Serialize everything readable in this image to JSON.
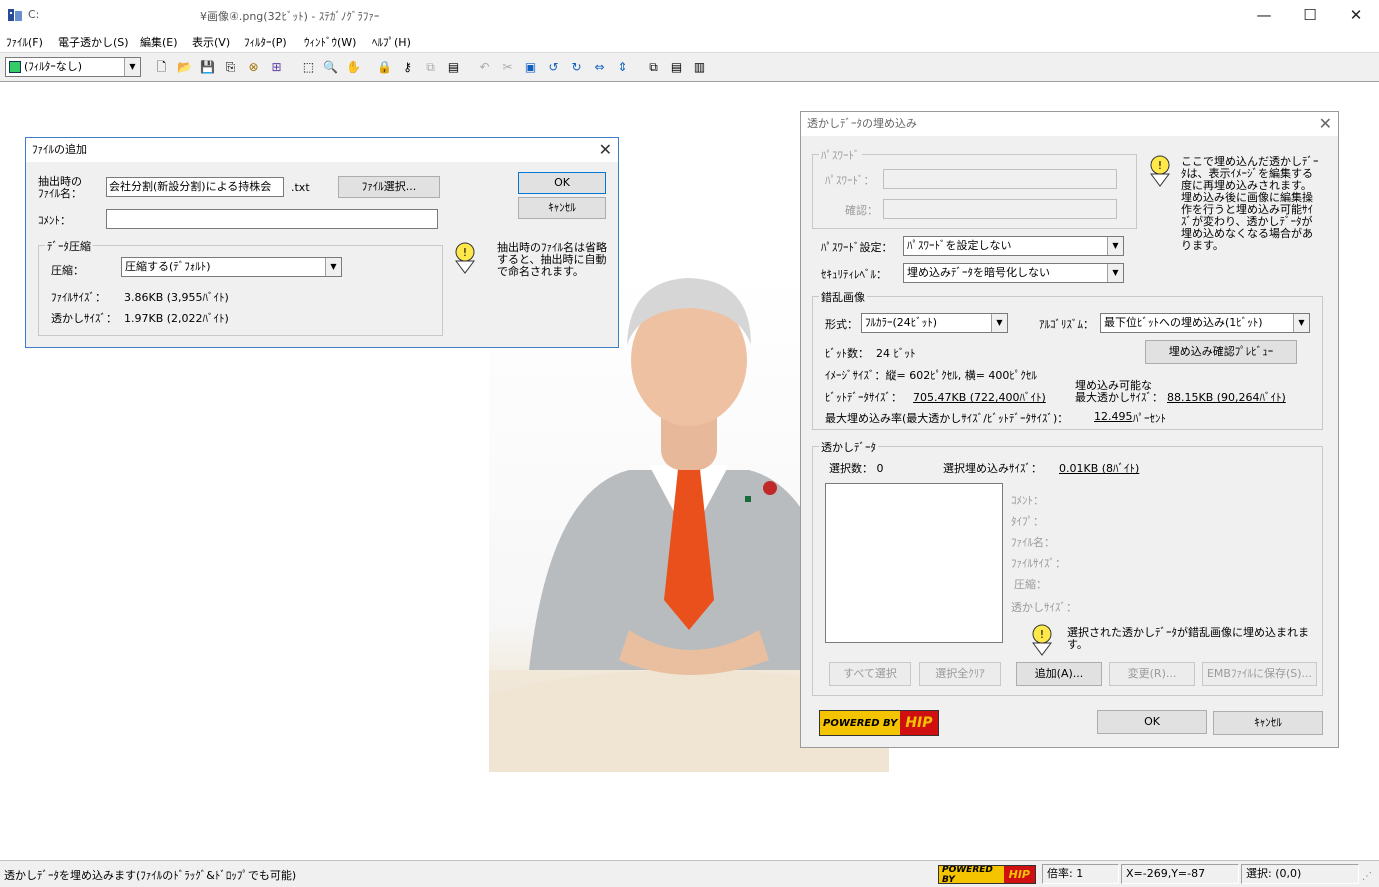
{
  "window": {
    "path": "C:",
    "title": "¥画像④.png(32ﾋﾞｯﾄ) - ｽﾃｶﾞﾉｸﾞﾗﾌｧｰ",
    "min": "—",
    "max": "☐",
    "close": "✕"
  },
  "menu": [
    "ﾌｧｲﾙ(F)",
    "電子透かし(S)",
    "編集(E)",
    "表示(V)",
    "ﾌｨﾙﾀｰ(P)",
    "ｳｨﾝﾄﾞｳ(W)",
    "ﾍﾙﾌﾟ(H)"
  ],
  "toolbar": {
    "filter_value": "(ﾌｨﾙﾀｰなし)"
  },
  "add_file_dialog": {
    "title": "ﾌｧｲﾙの追加",
    "close": "✕",
    "filename_label": "抽出時の\nﾌｧｲﾙ名：",
    "filename_value": "会社分割(新設分割)による持株会",
    "filename_ext": ".txt",
    "file_select_button": "ﾌｧｲﾙ選択...",
    "ok_button": "OK",
    "cancel_button": "ｷｬﾝｾﾙ",
    "comment_label": "ｺﾒﾝﾄ：",
    "comment_value": "",
    "compress_group": "ﾃﾞｰﾀ圧縮",
    "compress_label": "圧縮：",
    "compress_value": "圧縮する(ﾃﾞﾌｫﾙﾄ)",
    "file_size_label": "ﾌｧｲﾙｻｲｽﾞ：",
    "file_size_value": "3.86KB (3,955ﾊﾞｲﾄ)",
    "wm_size_label": "透かしｻｲｽﾞ：",
    "wm_size_value": "1.97KB (2,022ﾊﾞｲﾄ)",
    "hint": "抽出時のﾌｧｲﾙ名は省略すると、抽出時に自動で命名されます。"
  },
  "embed_dialog": {
    "title": "透かしﾃﾞｰﾀの埋め込み",
    "close": "✕",
    "password_group": "ﾊﾟｽﾜｰﾄﾞ",
    "password_label": "ﾊﾟｽﾜｰﾄﾞ：",
    "confirm_label": "確認：",
    "hint_top": "ここで埋め込んだ透かしﾃﾞｰﾀは、表示ｲﾒｰｼﾞを編集する度に再埋め込みされます。埋め込み後に画像に編集操作を行うと埋め込み可能ｻｲｽﾞが変わり、透かしﾃﾞｰﾀが埋め込めなくなる場合があります。",
    "pw_setting_label": "ﾊﾟｽﾜｰﾄﾞ設定：",
    "pw_setting_value": "ﾊﾟｽﾜｰﾄﾞを設定しない",
    "security_label": "ｾｷｭﾘﾃｨﾚﾍﾞﾙ：",
    "security_value": "埋め込みﾃﾞｰﾀを暗号化しない",
    "cipher_group": "錯乱画像",
    "format_label": "形式：",
    "format_value": "ﾌﾙｶﾗｰ(24ﾋﾞｯﾄ)",
    "algo_label": "ｱﾙｺﾞﾘｽﾞﾑ：",
    "algo_value": "最下位ﾋﾞｯﾄへの埋め込み(1ﾋﾞｯﾄ)",
    "bit_count_label": "ﾋﾞｯﾄ数：",
    "bit_count_value": "24 ﾋﾞｯﾄ",
    "preview_button": "埋め込み確認ﾌﾟﾚﾋﾞｭｰ",
    "image_size": "ｲﾒｰｼﾞｻｲｽﾞ：縦= 602ﾋﾟｸｾﾙ, 横= 400ﾋﾟｸｾﾙ",
    "bitdata_label": "ﾋﾞｯﾄﾃﾞｰﾀｻｲｽﾞ：",
    "bitdata_value": "705.47KB (722,400ﾊﾞｲﾄ)",
    "max_label_1": "埋め込み可能な",
    "max_label_2": "最大透かしｻｲｽﾞ：",
    "max_value": "88.15KB (90,264ﾊﾞｲﾄ)",
    "ratio_label": "最大埋め込み率(最大透かしｻｲｽﾞ/ﾋﾞｯﾄﾃﾞｰﾀｻｲｽﾞ)：",
    "ratio_value": "12.495",
    "ratio_unit": "ﾊﾟｰｾﾝﾄ",
    "wm_group": "透かしﾃﾞｰﾀ",
    "selected_count": "選択数： 0",
    "selected_size_label": "選択埋め込みｻｲｽﾞ：",
    "selected_size_value": "0.01KB (8ﾊﾞｲﾄ)",
    "detail_labels": [
      "ｺﾒﾝﾄ：",
      "ﾀｲﾌﾟ：",
      "ﾌｧｲﾙ名：",
      "ﾌｧｲﾙｻｲｽﾞ：",
      "圧縮：",
      "透かしｻｲｽﾞ："
    ],
    "hint_bottom": "選択された透かしﾃﾞｰﾀが錯乱画像に埋め込まれます。",
    "select_all": "すべて選択",
    "clear_all": "選択全ｸﾘｱ",
    "add": "追加(A)...",
    "change": "変更(R)...",
    "save_emb": "EMBﾌｧｲﾙに保存(S)...",
    "ok": "OK",
    "cancel": "ｷｬﾝｾﾙ"
  },
  "logo": {
    "powered": "POWERED BY",
    "brand": "HIP"
  },
  "status": {
    "message": "透かしﾃﾞｰﾀを埋め込みます(ﾌｧｲﾙのﾄﾞﾗｯｸﾞ&ﾄﾞﾛｯﾌﾟでも可能)",
    "zoom": "倍率: 1",
    "coords": "X=-269,Y=-87",
    "selection": "選択: (0,0)"
  },
  "colors": {
    "accent": "#0078d7",
    "logo_yellow": "#f4c400",
    "logo_red": "#d01010"
  }
}
